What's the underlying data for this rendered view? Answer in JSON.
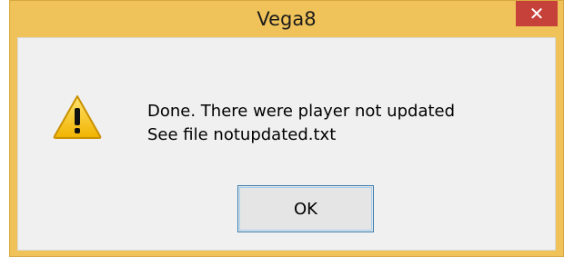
{
  "window": {
    "title": "Vega8",
    "close_icon": "close-icon",
    "accent": "#f0c35a"
  },
  "dialog": {
    "icon": "warning-icon",
    "message_line1": "Done. There were player not updated",
    "message_line2": "See file notupdated.txt",
    "ok_label": "OK"
  }
}
